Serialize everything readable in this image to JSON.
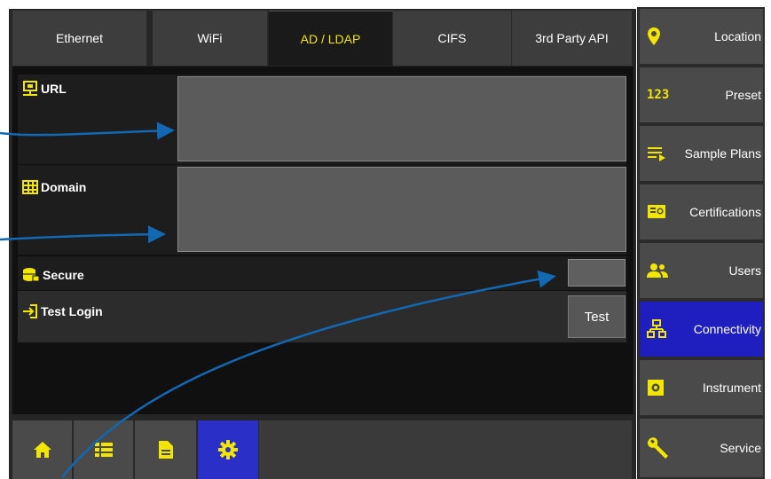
{
  "tabs": [
    {
      "label": "Ethernet"
    },
    {
      "label": "WiFi"
    },
    {
      "label": "AD / LDAP"
    },
    {
      "label": "CIFS"
    },
    {
      "label": "3rd Party API"
    }
  ],
  "active_tab": "AD / LDAP",
  "form": {
    "url_label": "URL",
    "url_value": "",
    "domain_label": "Domain",
    "domain_value": "",
    "secure_label": "Secure",
    "test_login_label": "Test Login",
    "test_button": "Test"
  },
  "sidebar": {
    "items": [
      {
        "label": "Location",
        "icon": "location-pin-icon"
      },
      {
        "label": "Preset",
        "icon": "numbers-123-icon"
      },
      {
        "label": "Sample Plans",
        "icon": "list-play-icon"
      },
      {
        "label": "Certifications",
        "icon": "certificate-icon"
      },
      {
        "label": "Users",
        "icon": "users-icon"
      },
      {
        "label": "Connectivity",
        "icon": "network-icon"
      },
      {
        "label": "Instrument",
        "icon": "instrument-icon"
      },
      {
        "label": "Service",
        "icon": "wrench-icon"
      }
    ],
    "active": "Connectivity"
  },
  "bottom_bar": {
    "buttons": [
      {
        "icon": "home-icon"
      },
      {
        "icon": "list-icon"
      },
      {
        "icon": "document-icon"
      },
      {
        "icon": "gear-icon"
      }
    ],
    "active": "gear-icon"
  },
  "colors": {
    "accent_yellow": "#f2e600",
    "active_blue": "#1f1fbf",
    "annotation_arrow": "#1268b3"
  }
}
